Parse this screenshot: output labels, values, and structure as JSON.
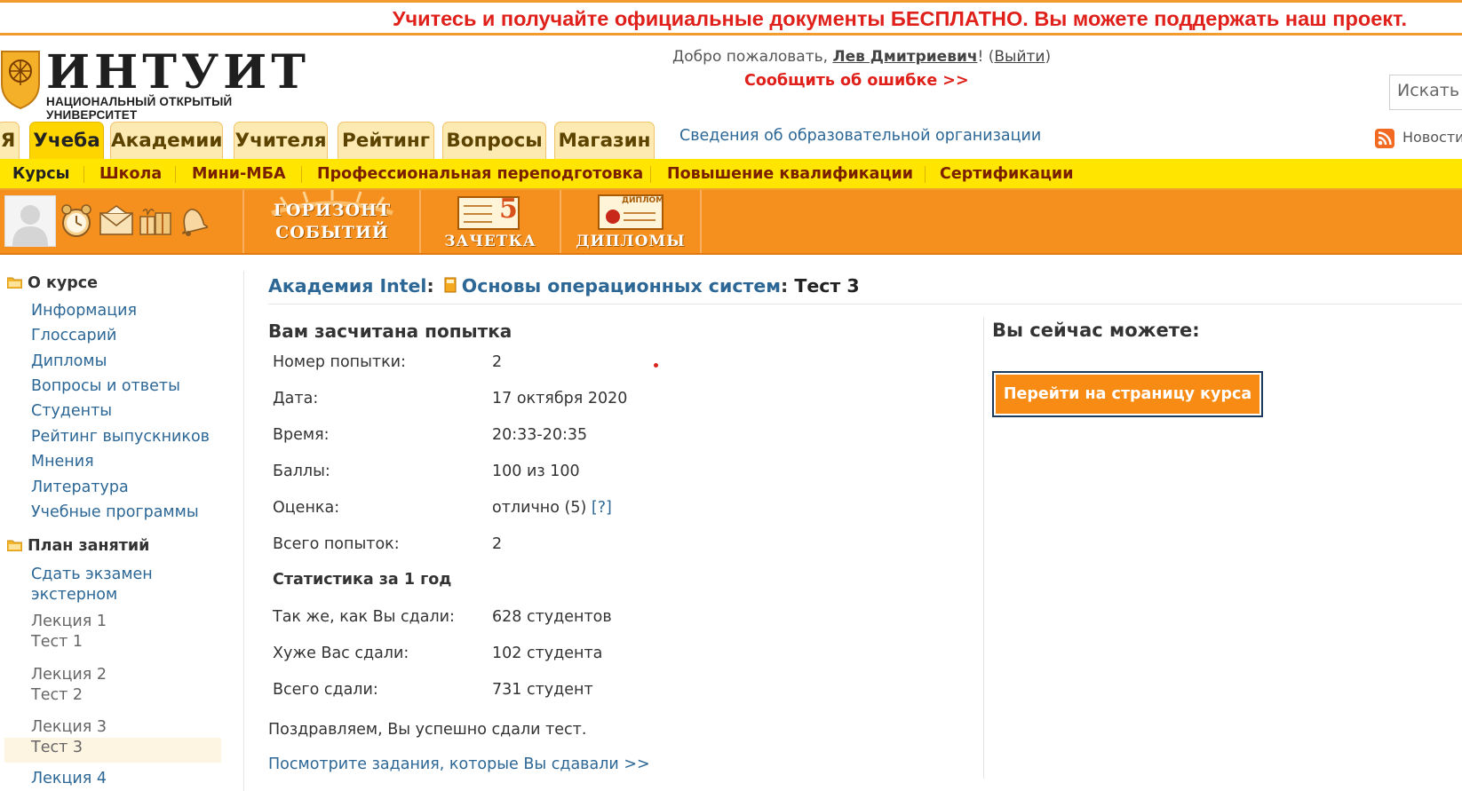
{
  "promo": {
    "text": "Учитесь и получайте официальные документы БЕСПЛАТНО. Вы можете поддержать наш проект."
  },
  "header": {
    "logo_title": "ИНТУИТ",
    "logo_subtitle": "НАЦИОНАЛЬНЫЙ ОТКРЫТЫЙ УНИВЕРСИТЕТ",
    "welcome_prefix": "Добро пожаловать, ",
    "user_name": "Лев Дмитриевич",
    "welcome_excl": "! (",
    "logout": "Выйти",
    "welcome_close": ")",
    "report_error": "Сообщить об ошибке >>",
    "search_placeholder": "Искать",
    "edu_info_link": "Сведения об образовательной организации",
    "news_link": "Новости"
  },
  "tabs": [
    {
      "label": "Я",
      "active": false
    },
    {
      "label": "Учеба",
      "active": true
    },
    {
      "label": "Академии",
      "active": false
    },
    {
      "label": "Учителя",
      "active": false
    },
    {
      "label": "Рейтинг",
      "active": false
    },
    {
      "label": "Вопросы",
      "active": false
    },
    {
      "label": "Магазин",
      "active": false
    }
  ],
  "subnav": [
    "Курсы",
    "Школа",
    "Мини-МБА",
    "Профессиональная переподготовка",
    "Повышение квалификации",
    "Сертификации"
  ],
  "toolbar": {
    "icons": [
      "alarm-clock-icon",
      "envelope-icon",
      "gifts-icon",
      "bell-icon"
    ],
    "horizon_line1": "ГОРИЗОНТ",
    "horizon_line2": "СОБЫТИЙ",
    "gradebook_number": "5",
    "gradebook_label": "ЗАЧЕТКА",
    "diploma_badge": "ДИПЛОМ",
    "diplomas_label": "ДИПЛОМЫ"
  },
  "sidebar": {
    "about_heading": "О курсе",
    "about_links": [
      "Информация",
      "Глоссарий",
      "Дипломы",
      "Вопросы и ответы",
      "Студенты",
      "Рейтинг выпускников",
      "Мнения",
      "Литература",
      "Учебные программы"
    ],
    "plan_heading": "План занятий",
    "exam_line1": "Сдать экзамен",
    "exam_line2": "экстерном",
    "lectures": [
      {
        "lecture": "Лекция 1",
        "test": "Тест 1"
      },
      {
        "lecture": "Лекция 2",
        "test": "Тест 2"
      },
      {
        "lecture": "Лекция 3",
        "test": "Тест 3"
      },
      {
        "lecture": "Лекция 4"
      }
    ]
  },
  "breadcrumb": {
    "academy": "Академия Intel",
    "sep1": ":",
    "course": "Основы операционных систем",
    "sep2": ":",
    "current": "Тест 3"
  },
  "result": {
    "title": "Вам засчитана попытка",
    "rows": [
      {
        "label": "Номер попытки:",
        "value": "2"
      },
      {
        "label": "Дата:",
        "value": "17 октября 2020"
      },
      {
        "label": "Время:",
        "value": "20:33-20:35"
      },
      {
        "label": "Баллы:",
        "value": "100 из 100"
      },
      {
        "label": "Оценка:",
        "value": "отлично (5)",
        "help": "[?]"
      },
      {
        "label": "Всего попыток:",
        "value": "2"
      }
    ],
    "stats_title": "Статистика за 1 год",
    "stats": [
      {
        "label": "Так же, как Вы сдали:",
        "value": "628 студентов"
      },
      {
        "label": "Хуже Вас сдали:",
        "value": "102 студента"
      },
      {
        "label": "Всего сдали:",
        "value": "731 студент"
      }
    ],
    "congrats": "Поздравляем, Вы успешно сдали тест.",
    "tasks_link": "Посмотрите задания, которые Вы сдавали >>"
  },
  "actions": {
    "title": "Вы сейчас можете:",
    "course_button": "Перейти на страницу курса"
  },
  "colors": {
    "accent_orange": "#f5901e",
    "tab_yellow": "#ffd500",
    "link_blue": "#2c6796",
    "alert_red": "#e0201a"
  }
}
